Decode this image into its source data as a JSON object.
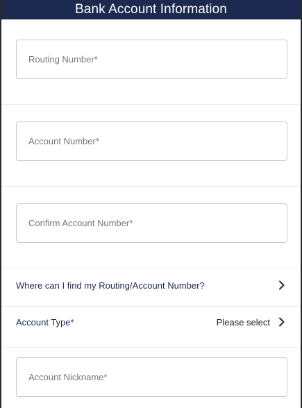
{
  "header": {
    "title": "Bank Account Information"
  },
  "fields": {
    "routing": {
      "placeholder": "Routing Number*",
      "value": ""
    },
    "account": {
      "placeholder": "Account Number*",
      "value": ""
    },
    "confirm_account": {
      "placeholder": "Confirm Account Number*",
      "value": ""
    },
    "nickname": {
      "placeholder": "Account Nickname*",
      "value": ""
    }
  },
  "help_link": {
    "label": "Where can I find my Routing/Account Number?",
    "icon": "chevron-right-icon"
  },
  "account_type": {
    "label": "Account Type*",
    "value": "Please select",
    "icon": "chevron-right-icon"
  },
  "colors": {
    "header_bg": "#1b2a4e",
    "link_text": "#1b2a4e",
    "field_border": "#c9c9c9"
  }
}
